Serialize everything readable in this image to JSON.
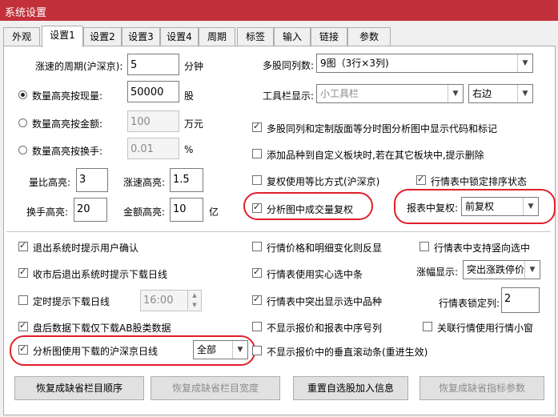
{
  "window": {
    "title": "系统设置"
  },
  "tabs": [
    "外观",
    "设置1",
    "设置2",
    "设置3",
    "设置4",
    "周期",
    "标签",
    "输入",
    "链接",
    "参数"
  ],
  "active_tab": "设置1",
  "left": {
    "period_label": "涨速的周期(沪深京):",
    "period_value": "5",
    "period_unit": "分钟",
    "radios": [
      {
        "label": "数量高亮按现量:",
        "value": "50000",
        "unit": "股",
        "selected": true
      },
      {
        "label": "数量高亮按金额:",
        "value": "100",
        "unit": "万元",
        "selected": false
      },
      {
        "label": "数量高亮按换手:",
        "value": "0.01",
        "unit": "%",
        "selected": false
      }
    ],
    "liangbi_label": "量比高亮:",
    "liangbi_value": "3",
    "zhangsu_label": "涨速高亮:",
    "zhangsu_value": "1.5",
    "huanshou_label": "换手高亮:",
    "huanshou_value": "20",
    "jine_label": "金额高亮:",
    "jine_value": "10",
    "jine_unit": "亿"
  },
  "right": {
    "multi_label": "多股同列数:",
    "multi_value": "9图（3行×3列)",
    "toolbar_label": "工具栏显示:",
    "toolbar_value": "小工具栏",
    "toolbar_pos": "右边",
    "cb_show_code": "多股同列和定制版面等分时图分析图中显示代码和标记",
    "cb_add_stock": "添加品种到自定义板块时,若在其它板块中,提示删除",
    "cb_fuquan": "复权使用等比方式(沪深京)",
    "cb_lock_sort": "行情表中锁定排序状态",
    "cb_volume_fuquan": "分析图中成交量复权",
    "report_fuquan_label": "报表中复权:",
    "report_fuquan_value": "前复权"
  },
  "bottom": {
    "cb_exit_confirm": "退出系统时提示用户确认",
    "cb_close_download": "收市后退出系统时提示下载日线",
    "cb_timed_download": "定时提示下载日线",
    "timed_value": "16:00",
    "cb_after_ab": "盘后数据下载仅下载AB股类数据",
    "cb_use_downloaded": "分析图使用下载的沪深京日线",
    "use_downloaded_value": "全部",
    "cb_price_color": "行情价格和明细变化则反显",
    "cb_solid_select": "行情表使用实心选中条",
    "cb_highlight_item": "行情表中突出显示选中品种",
    "cb_no_quote_seq": "不显示报价和报表中序号列",
    "cb_no_vscroll": "不显示报价中的垂直滚动条(重进生效)",
    "cb_vertical_select": "行情表中支持竖向选中",
    "zhangfu_label": "涨幅显示:",
    "zhangfu_value": "突出涨跌停价",
    "lock_col_label": "行情表锁定列:",
    "lock_col_value": "2",
    "cb_linked_small": "关联行情使用行情小窗"
  },
  "buttons": {
    "restore_col_order": "恢复成缺省栏目顺序",
    "restore_col_width": "恢复成缺省栏目宽度",
    "reset_self_select": "重置自选股加入信息",
    "restore_indicator": "恢复成缺省指标参数"
  },
  "colors": {
    "title_bar": "#c2303a",
    "highlight_ring": "#e0202a"
  }
}
